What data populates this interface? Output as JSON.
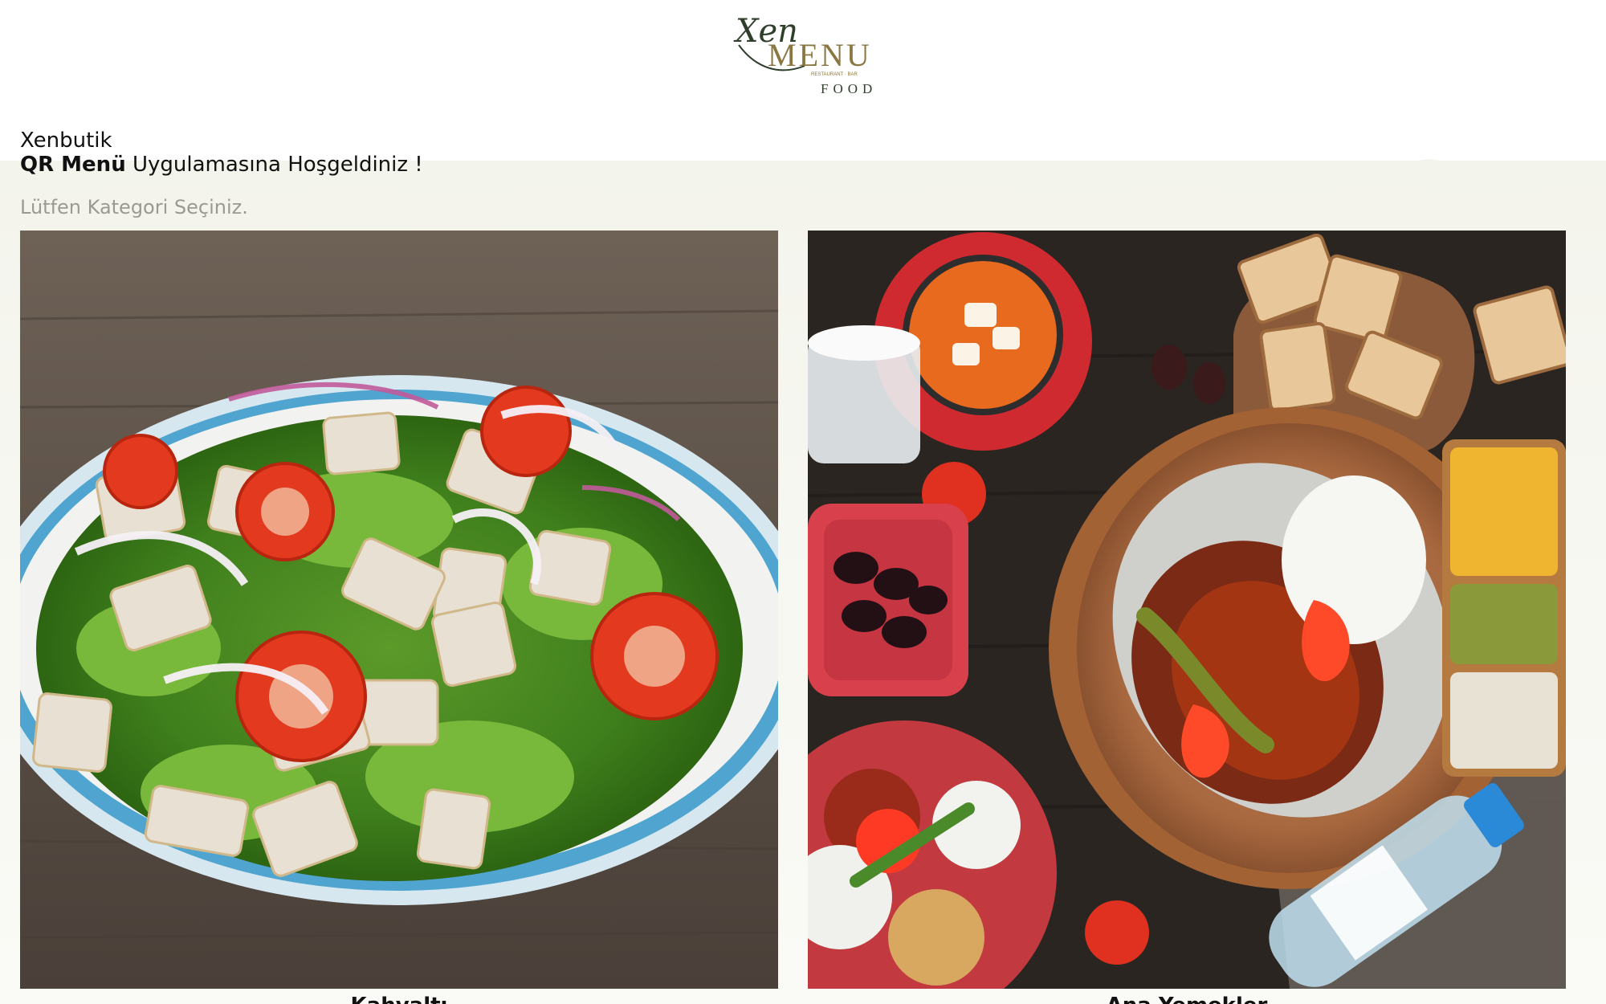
{
  "brand": {
    "script": "Xen",
    "word": "MENU",
    "tagline": "RESTAURANT · BAR",
    "sub": "FOOD"
  },
  "welcome": {
    "venue": "Xenbutik",
    "app_bold": "QR Menü",
    "app_rest": " Uygulamasına Hoşgeldiniz !"
  },
  "hint": "Lütfen Kategori Seçiniz.",
  "categories": [
    {
      "label": "Kahvaltı",
      "image": "salad-photo"
    },
    {
      "label": "Ana Yemekler",
      "image": "iskender-meal-photo"
    }
  ],
  "colors": {
    "brand_gold": "#8a7640",
    "brand_green": "#2f3f2c",
    "hint_gray": "#9a9a92"
  }
}
